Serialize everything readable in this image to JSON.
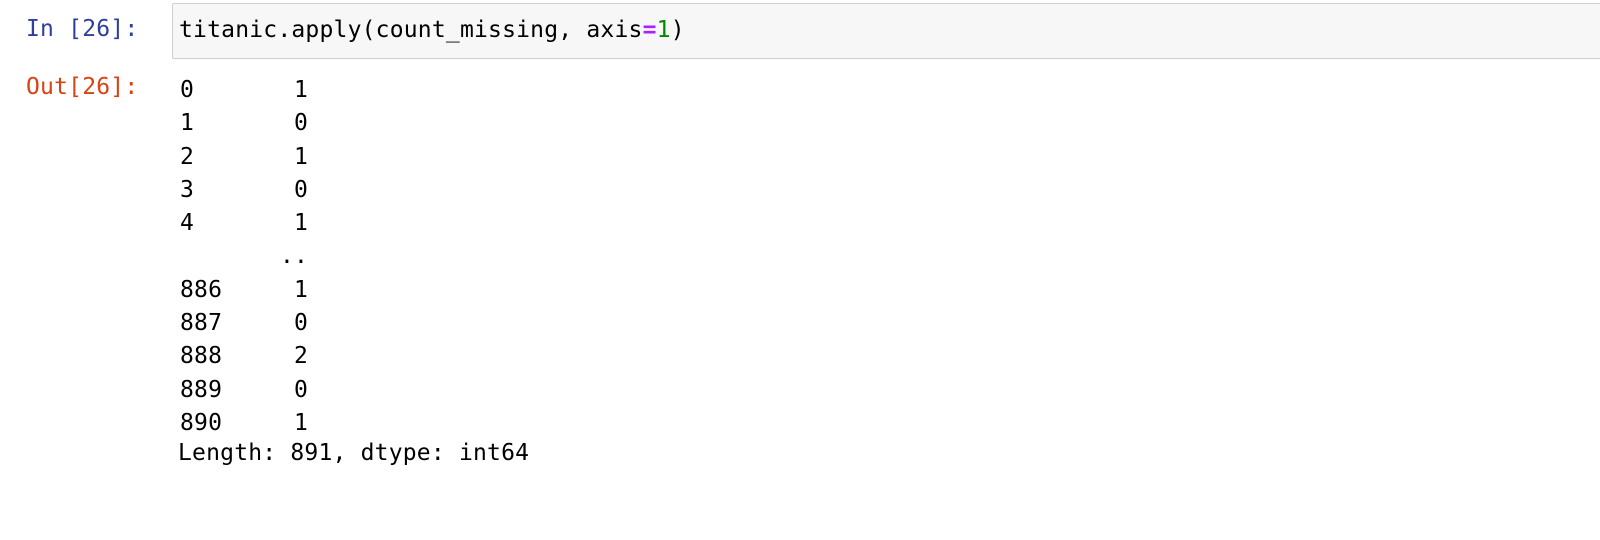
{
  "input_cell": {
    "prompt": "In [26]:",
    "code_parts": {
      "prefix": "titanic.apply(count_missing, axis",
      "operator": "=",
      "number": "1",
      "suffix": ")"
    }
  },
  "output_cell": {
    "prompt": "Out[26]:",
    "rows": [
      {
        "index": "0",
        "value": "1"
      },
      {
        "index": "1",
        "value": "0"
      },
      {
        "index": "2",
        "value": "1"
      },
      {
        "index": "3",
        "value": "0"
      },
      {
        "index": "4",
        "value": "1"
      }
    ],
    "ellipsis": "..",
    "rows_tail": [
      {
        "index": "886",
        "value": "1"
      },
      {
        "index": "887",
        "value": "0"
      },
      {
        "index": "888",
        "value": "2"
      },
      {
        "index": "889",
        "value": "0"
      },
      {
        "index": "890",
        "value": "1"
      }
    ],
    "footer": "Length: 891, dtype: int64"
  },
  "colors": {
    "in_prompt": "#303f9f",
    "out_prompt": "#d84315",
    "operator": "#aa22ff",
    "number": "#008800",
    "editor_background": "#f7f7f7"
  }
}
